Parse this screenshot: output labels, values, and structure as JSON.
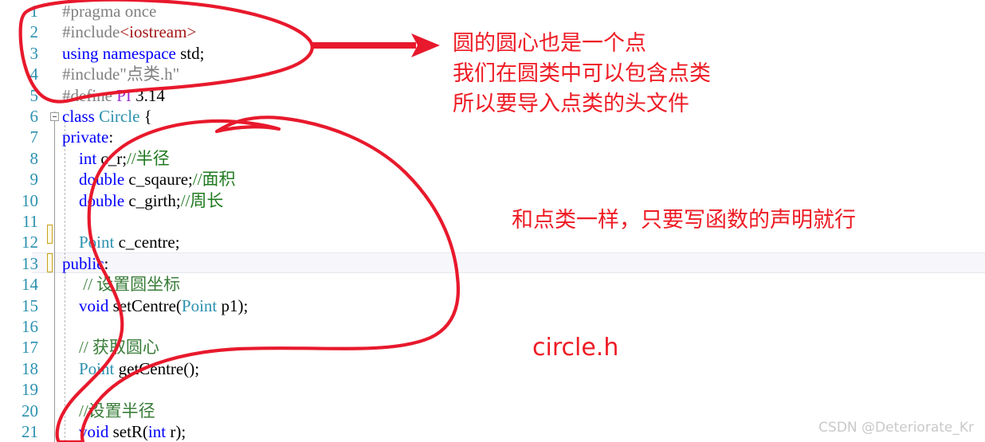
{
  "editor": {
    "line_numbers": [
      "1",
      "2",
      "3",
      "4",
      "5",
      "6",
      "7",
      "8",
      "9",
      "10",
      "11",
      "12",
      "13",
      "14",
      "15",
      "16",
      "17",
      "18",
      "19",
      "20",
      "21"
    ],
    "lines": [
      {
        "n": 1,
        "segments": [
          {
            "t": "#pragma once",
            "c": "tok-pre"
          }
        ]
      },
      {
        "n": 2,
        "segments": [
          {
            "t": "#include",
            "c": "tok-pre"
          },
          {
            "t": "<iostream>",
            "c": "tok-inc"
          }
        ]
      },
      {
        "n": 3,
        "segments": [
          {
            "t": "using namespace ",
            "c": "tok-kw"
          },
          {
            "t": "std;",
            "c": "tok-id"
          }
        ]
      },
      {
        "n": 4,
        "segments": [
          {
            "t": "#include\"点类.h\"",
            "c": "tok-pre"
          }
        ]
      },
      {
        "n": 5,
        "segments": [
          {
            "t": "#define ",
            "c": "tok-pre"
          },
          {
            "t": "PI",
            "c": "tok-macro"
          },
          {
            "t": " 3.14",
            "c": "tok-num"
          }
        ]
      },
      {
        "n": 6,
        "segments": [
          {
            "t": "class ",
            "c": "tok-kw"
          },
          {
            "t": "Circle",
            "c": "tok-type"
          },
          {
            "t": " {",
            "c": "tok-id"
          }
        ]
      },
      {
        "n": 7,
        "segments": [
          {
            "t": "private",
            "c": "tok-kw"
          },
          {
            "t": ":",
            "c": "tok-id"
          }
        ]
      },
      {
        "n": 8,
        "segments": [
          {
            "t": "    int",
            "c": "tok-kw"
          },
          {
            "t": " c_r;",
            "c": "tok-id"
          },
          {
            "t": "//半径",
            "c": "tok-cmt"
          }
        ]
      },
      {
        "n": 9,
        "segments": [
          {
            "t": "    double",
            "c": "tok-kw"
          },
          {
            "t": " c_sqaure;",
            "c": "tok-id"
          },
          {
            "t": "//面积",
            "c": "tok-cmt"
          }
        ]
      },
      {
        "n": 10,
        "segments": [
          {
            "t": "    double",
            "c": "tok-kw"
          },
          {
            "t": " c_girth;",
            "c": "tok-id"
          },
          {
            "t": "//周长",
            "c": "tok-cmt"
          }
        ]
      },
      {
        "n": 11,
        "segments": [
          {
            "t": "",
            "c": "tok-id"
          }
        ]
      },
      {
        "n": 12,
        "segments": [
          {
            "t": "    ",
            "c": "tok-id"
          },
          {
            "t": "Point",
            "c": "tok-type"
          },
          {
            "t": " c_centre;",
            "c": "tok-id"
          }
        ]
      },
      {
        "n": 13,
        "segments": [
          {
            "t": "public",
            "c": "tok-kw"
          },
          {
            "t": ":",
            "c": "tok-id"
          }
        ]
      },
      {
        "n": 14,
        "segments": [
          {
            "t": "     // 设置圆坐标",
            "c": "tok-cmt2"
          }
        ]
      },
      {
        "n": 15,
        "segments": [
          {
            "t": "    void",
            "c": "tok-kw"
          },
          {
            "t": " setCentre(",
            "c": "tok-id"
          },
          {
            "t": "Point",
            "c": "tok-type"
          },
          {
            "t": " p1);",
            "c": "tok-id"
          }
        ]
      },
      {
        "n": 16,
        "segments": [
          {
            "t": "",
            "c": "tok-id"
          }
        ]
      },
      {
        "n": 17,
        "segments": [
          {
            "t": "    // 获取圆心",
            "c": "tok-cmt2"
          }
        ]
      },
      {
        "n": 18,
        "segments": [
          {
            "t": "    ",
            "c": "tok-id"
          },
          {
            "t": "Point",
            "c": "tok-type"
          },
          {
            "t": " getCentre();",
            "c": "tok-id"
          }
        ]
      },
      {
        "n": 19,
        "segments": [
          {
            "t": "",
            "c": "tok-id"
          }
        ]
      },
      {
        "n": 20,
        "segments": [
          {
            "t": "    //设置半径",
            "c": "tok-cmt2"
          }
        ]
      },
      {
        "n": 21,
        "segments": [
          {
            "t": "    void",
            "c": "tok-kw"
          },
          {
            "t": " setR(",
            "c": "tok-id"
          },
          {
            "t": "int",
            "c": "tok-kw"
          },
          {
            "t": " r);",
            "c": "tok-id"
          }
        ]
      }
    ],
    "change_marker_lines": [
      11,
      13
    ],
    "current_line": 13,
    "fold_marker_line": 6
  },
  "annotations": {
    "color": "#ee1b24",
    "note_top": "圆的圆心也是一个点\n我们在圆类中可以包含点类\n所以要导入点类的头文件",
    "note_middle": "和点类一样，只要写函数的声明就行",
    "note_filename": "circle.h",
    "arrow": "red-arrow-right",
    "lasso_top": "red-ellipse-lines-1-5",
    "lasso_body": "red-lasso-lines-7-21"
  },
  "watermark": {
    "text": "CSDN @Deteriorate_Kr",
    "color": "#c9c9c9"
  }
}
